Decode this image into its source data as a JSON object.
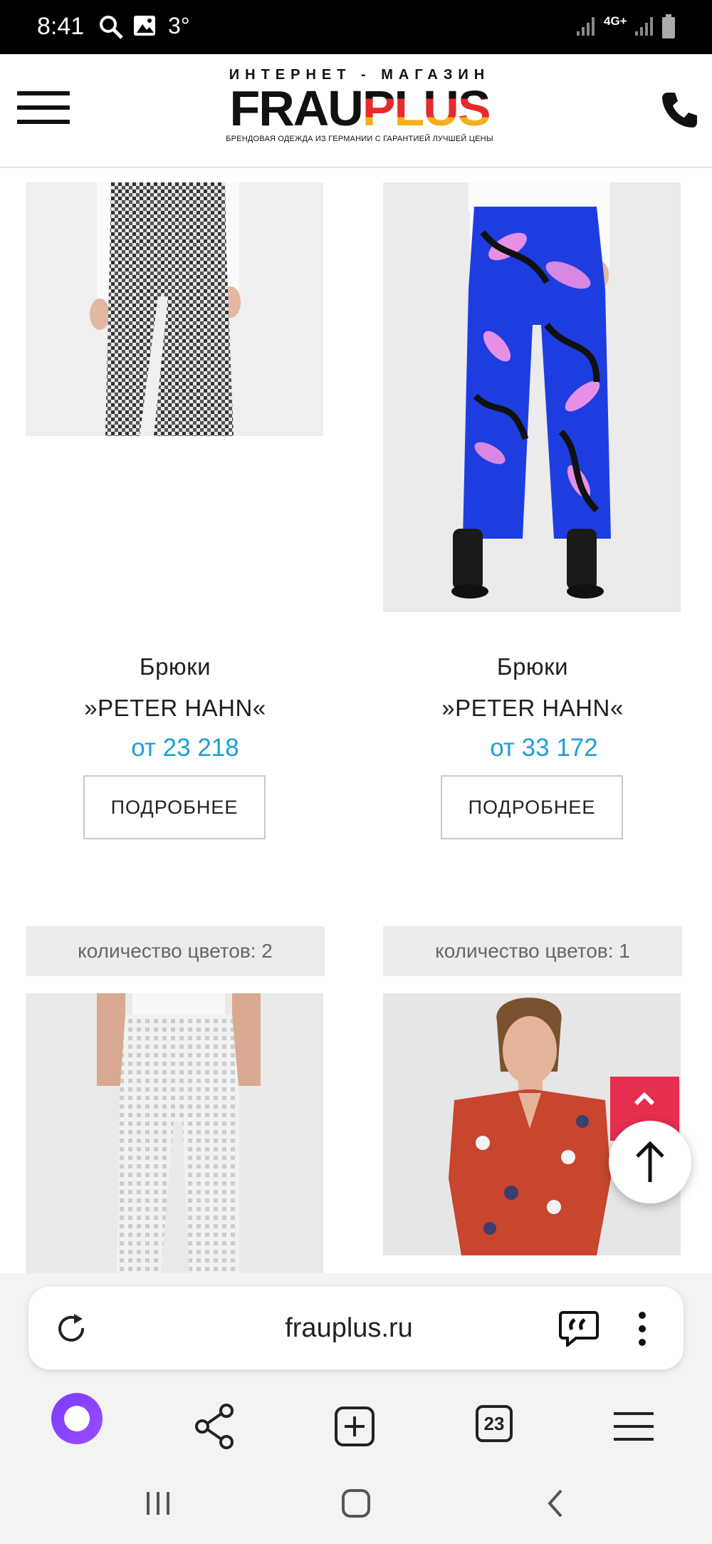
{
  "status": {
    "time": "8:41",
    "temp": "3°",
    "network": "4G+"
  },
  "header": {
    "logo_top": "ИНТЕРНЕТ - МАГАЗИН",
    "logo_frau": "FRAU",
    "logo_plus": "PLUS",
    "logo_sub": "БРЕНДОВАЯ ОДЕЖДА ИЗ ГЕРМАНИИ С ГАРАНТИЕЙ ЛУЧШЕЙ ЦЕНЫ"
  },
  "products": [
    {
      "title_line1": "Брюки",
      "title_line2": "»PETER HAHN«",
      "price": "от 23 218",
      "button": "ПОДРОБНЕЕ"
    },
    {
      "title_line1": "Брюки",
      "title_line2": "»PETER HAHN«",
      "price": "от 33 172",
      "button": "ПОДРОБНЕЕ"
    }
  ],
  "next_products": [
    {
      "colors": "количество цветов: 2"
    },
    {
      "colors": "количество цветов: 1"
    }
  ],
  "browser": {
    "url": "frauplus.ru",
    "tabs_count": "23"
  },
  "colors": {
    "accent_price": "#1c9fd6",
    "scroll_red": "#e62e4f",
    "alice_purple": "#7a3cff"
  }
}
